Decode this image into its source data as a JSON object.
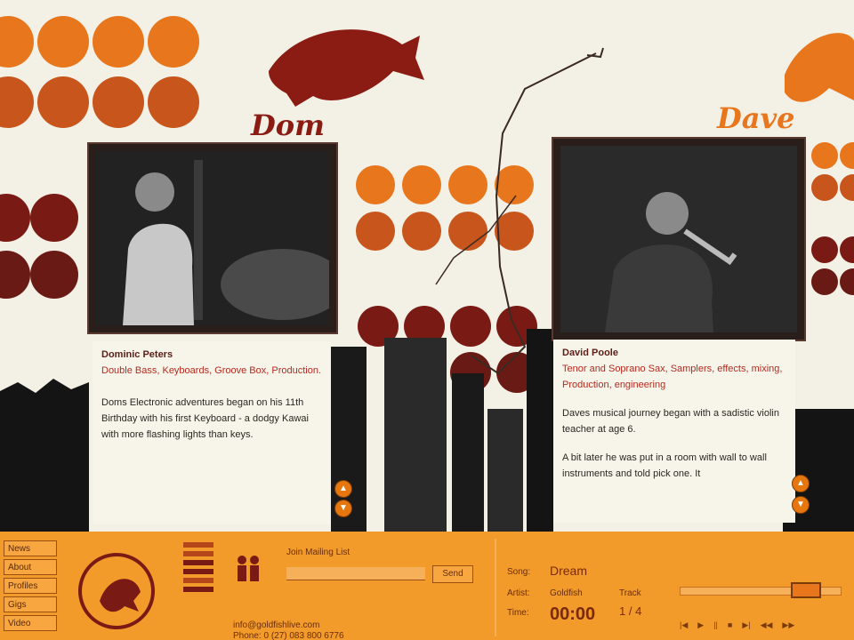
{
  "header": {
    "left_name": "Dom",
    "right_name": "Dave"
  },
  "members": [
    {
      "name": "Dominic Peters",
      "roles": "Double Bass, Keyboards, Groove Box, Production.",
      "bio": "Doms Electronic adventures began on his 11th Birthday with his first Keyboard - a dodgy Kawai with more flashing lights than keys."
    },
    {
      "name": "David Poole",
      "roles": "Tenor and Soprano Sax, Samplers, effects, mixing, Production, engineering",
      "bio": "Daves musical journey began with a sadistic violin teacher at age 6.",
      "bio2": "A bit later he was put in a room with wall to wall instruments and told pick one. It"
    }
  ],
  "nav": {
    "items": [
      "News",
      "About",
      "Profiles",
      "Gigs",
      "Video"
    ]
  },
  "mailing": {
    "title": "Join Mailing List",
    "send_label": "Send",
    "email": "info@goldfishlive.com",
    "phone": "Phone: 0 (27) 083 800 6776"
  },
  "player": {
    "song_label": "Song:",
    "song": "Dream",
    "artist_label": "Artist:",
    "artist": "Goldfish",
    "time_label": "Time:",
    "time": "00:00",
    "track_label": "Track",
    "track": "1 / 4",
    "controls": [
      "|◀",
      "▶",
      "||",
      "■",
      "▶|",
      "◀◀",
      "▶▶"
    ],
    "volume": 0.85
  },
  "colors": {
    "orange": "#f29a2a",
    "dark_red": "#7a1a14",
    "rust": "#c4521c",
    "cream": "#f3f0e6"
  }
}
